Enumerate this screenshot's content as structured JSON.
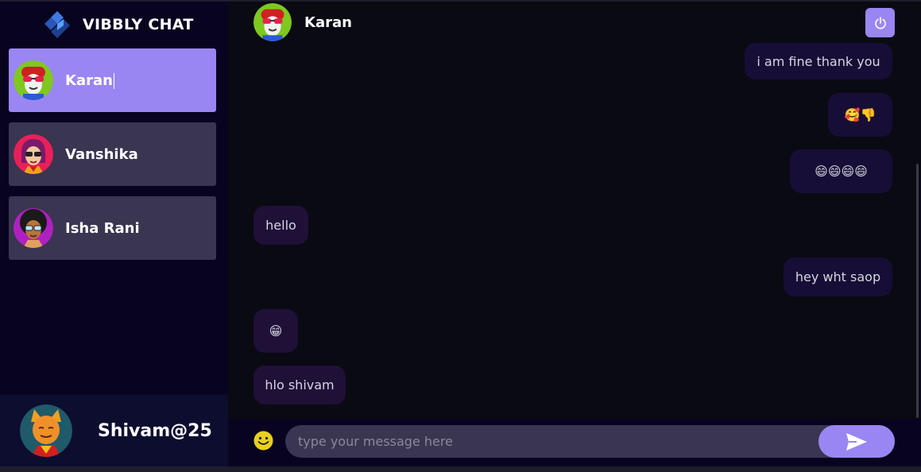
{
  "brand": {
    "name": "VIBBLY CHAT"
  },
  "contacts": [
    {
      "name": "Karan",
      "selected": true
    },
    {
      "name": "Vanshika",
      "selected": false
    },
    {
      "name": "Isha Rani",
      "selected": false
    }
  ],
  "current_user": {
    "name": "Shivam@25"
  },
  "chat_header": {
    "name": "Karan"
  },
  "messages": [
    {
      "text": "i am fine thank you",
      "direction": "sent"
    },
    {
      "text": "🥰👎",
      "direction": "sent"
    },
    {
      "text": "😄😄😄😄",
      "direction": "sent"
    },
    {
      "text": "hello",
      "direction": "received"
    },
    {
      "text": "hey wht saop",
      "direction": "sent"
    },
    {
      "text": "😁",
      "direction": "received"
    },
    {
      "text": "hlo shivam",
      "direction": "received"
    }
  ],
  "composer": {
    "placeholder": "type your message here"
  },
  "icons": {
    "logout": "power-icon",
    "emoji": "smiley-icon",
    "send": "send-arrow-icon",
    "brand": "brand-logo-icon"
  },
  "colors": {
    "accent": "#9a86f3",
    "sidebar_bg": "#080420",
    "chat_bg": "#0a0a13",
    "contact_bg": "#3a3550"
  }
}
